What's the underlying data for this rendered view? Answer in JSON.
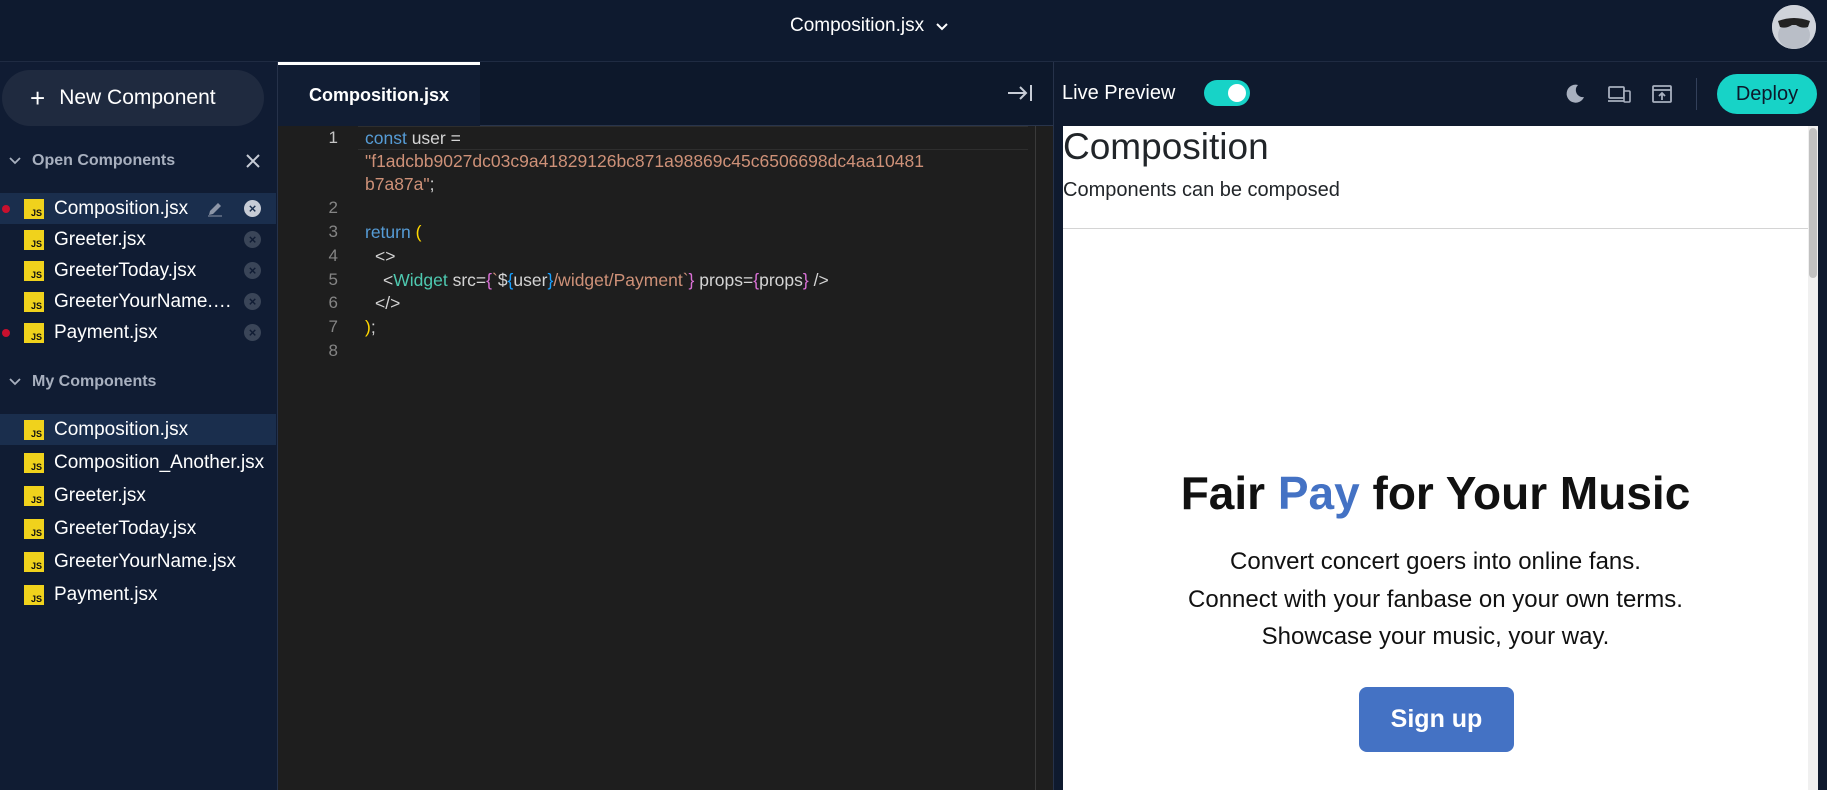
{
  "topbar": {
    "title": "Composition.jsx",
    "icons": {
      "dropdown": "chevron-down-icon",
      "avatar": "user-avatar"
    }
  },
  "sidebar": {
    "new_component": "New Component",
    "open_section": "Open Components",
    "my_section": "My Components",
    "file_badge": "JS",
    "open_files": [
      {
        "name": "Composition.jsx",
        "active": true,
        "unsaved": true,
        "editing": true
      },
      {
        "name": "Greeter.jsx",
        "active": false,
        "unsaved": false
      },
      {
        "name": "GreeterToday.jsx",
        "active": false,
        "unsaved": false
      },
      {
        "name": "GreeterYourName.jsx",
        "active": false,
        "unsaved": false
      },
      {
        "name": "Payment.jsx",
        "active": false,
        "unsaved": true
      }
    ],
    "my_files": [
      {
        "name": "Composition.jsx",
        "active": true
      },
      {
        "name": "Composition_Another.jsx",
        "active": false
      },
      {
        "name": "Greeter.jsx",
        "active": false
      },
      {
        "name": "GreeterToday.jsx",
        "active": false
      },
      {
        "name": "GreeterYourName.jsx",
        "active": false
      },
      {
        "name": "Payment.jsx",
        "active": false
      }
    ]
  },
  "editor": {
    "tab": "Composition.jsx",
    "line_numbers": [
      "1",
      "2",
      "3",
      "4",
      "5",
      "6",
      "7",
      "8"
    ],
    "code": {
      "l1_kw": "const",
      "l1_rest": " user =",
      "l1_str_a": "\"f1adcbb9027dc03c9a41829126bc871a98869c45c6506698dc4aa10481",
      "l1_str_b": "b7a87a\"",
      "l1_end": ";",
      "l3_kw": "return",
      "l3_paren": "(",
      "l4": "<>",
      "l5_open": "<",
      "l5_tag": "Widget",
      "l5_attr": " src=",
      "l5_brace1": "{",
      "l5_tick1": "`",
      "l5_dollar": "$",
      "l5_brace2": "{",
      "l5_var": "user",
      "l5_brace3": "}",
      "l5_path": "/widget/Payment",
      "l5_tick2": "`",
      "l5_brace4": "}",
      "l5_props": " props=",
      "l5_brace5": "{",
      "l5_propsvar": "props",
      "l5_brace6": "}",
      "l5_close": " />",
      "l6": "</>",
      "l7_paren": ")",
      "l7_semi": ";"
    }
  },
  "preview": {
    "label": "Live Preview",
    "toggle_on": true,
    "deploy": "Deploy",
    "icons": [
      "moon-icon",
      "devices-icon",
      "open-external-icon"
    ],
    "content": {
      "title": "Composition",
      "subtitle": "Components can be composed",
      "hero_a": "Fair ",
      "hero_b": "Pay",
      "hero_c": " for Your Music",
      "lines": [
        "Convert concert goers into online fans.",
        "Connect with your fanbase on your own terms.",
        "Showcase your music, your way."
      ],
      "signup": "Sign up"
    }
  },
  "colors": {
    "accent": "#17d3c7",
    "brand_blue": "#4472c4",
    "unsaved_dot": "#c8102e",
    "js_badge": "#f0d21c"
  }
}
